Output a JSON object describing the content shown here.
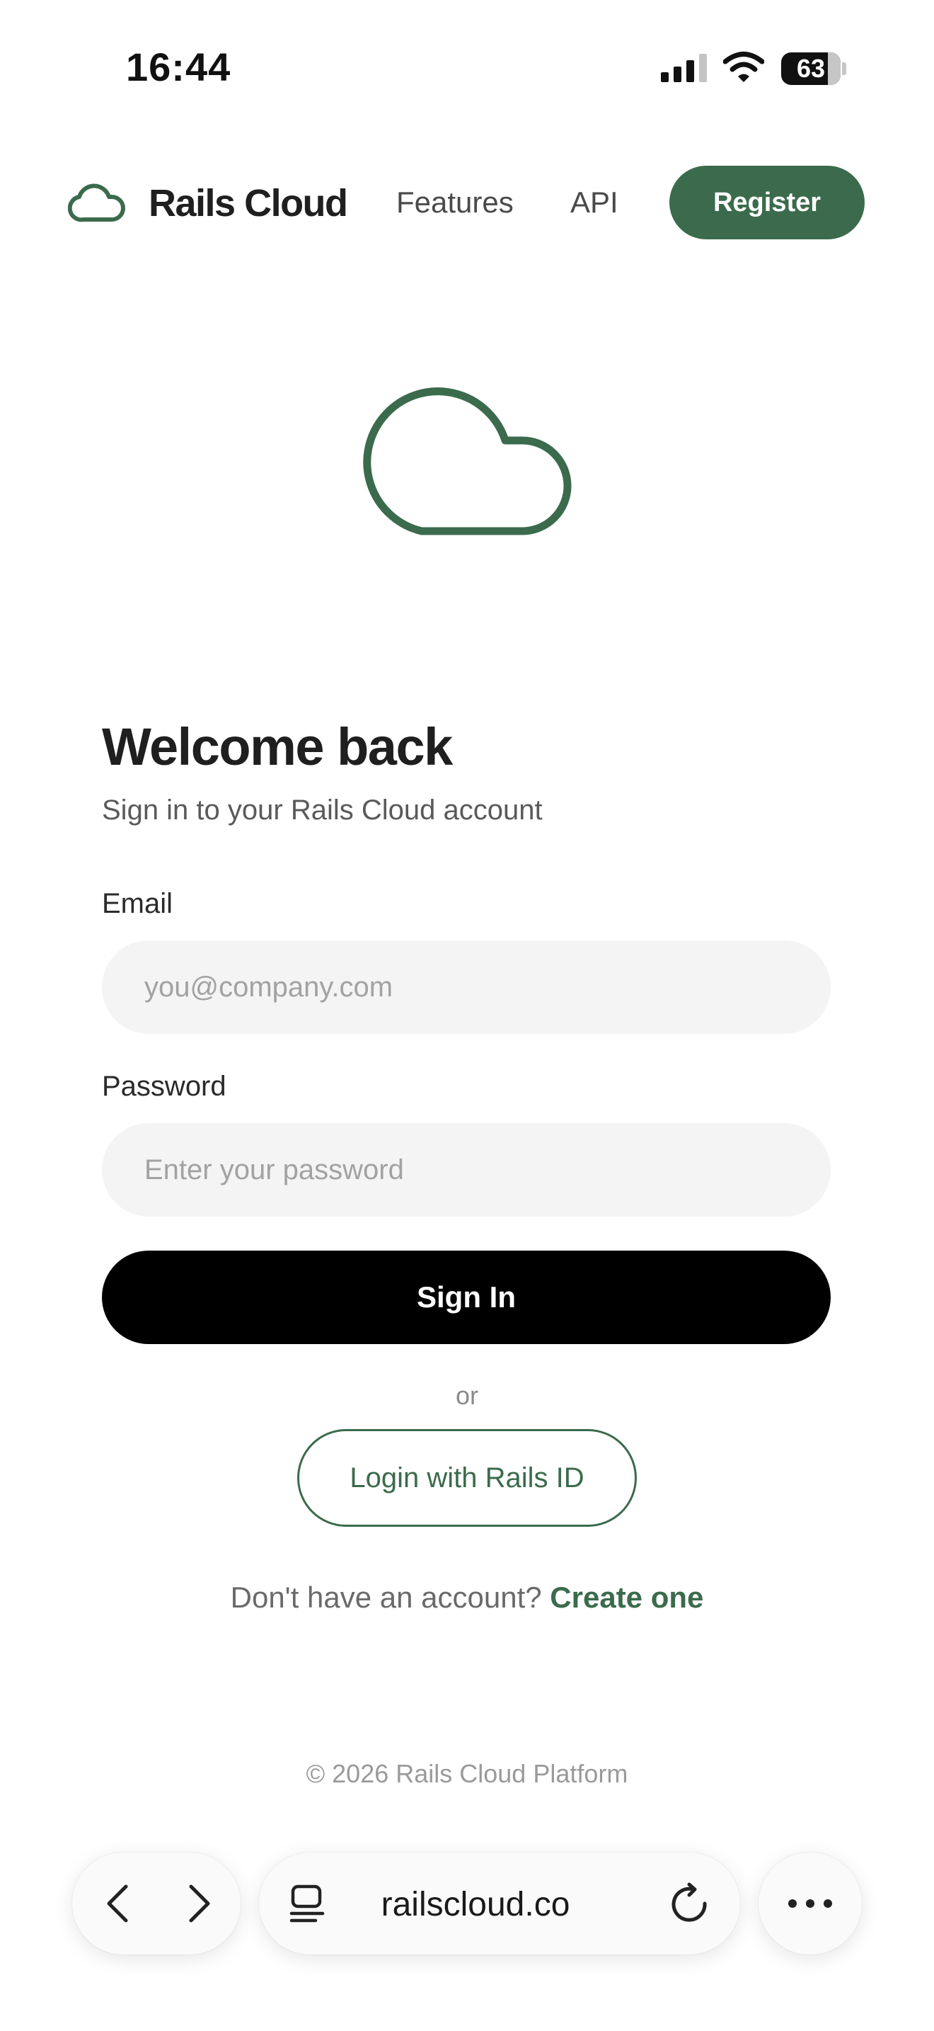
{
  "status_bar": {
    "time": "16:44",
    "battery_level": "63"
  },
  "nav": {
    "brand": "Rails Cloud",
    "links": [
      "Features",
      "API"
    ],
    "register_label": "Register"
  },
  "form": {
    "title": "Welcome back",
    "subtitle": "Sign in to your Rails Cloud account",
    "email_label": "Email",
    "email_placeholder": "you@company.com",
    "password_label": "Password",
    "password_placeholder": "Enter your password",
    "signin_label": "Sign In",
    "or_text": "or",
    "rails_id_label": "Login with Rails ID",
    "signup_prompt": "Don't have an account?",
    "signup_link": "Create one"
  },
  "footer": {
    "copyright": "© 2026 Rails Cloud Platform"
  },
  "browser": {
    "url": "railscloud.co"
  },
  "colors": {
    "brand_green": "#3b6b4c",
    "primary_button": "#000000",
    "input_bg": "#f4f4f4"
  }
}
